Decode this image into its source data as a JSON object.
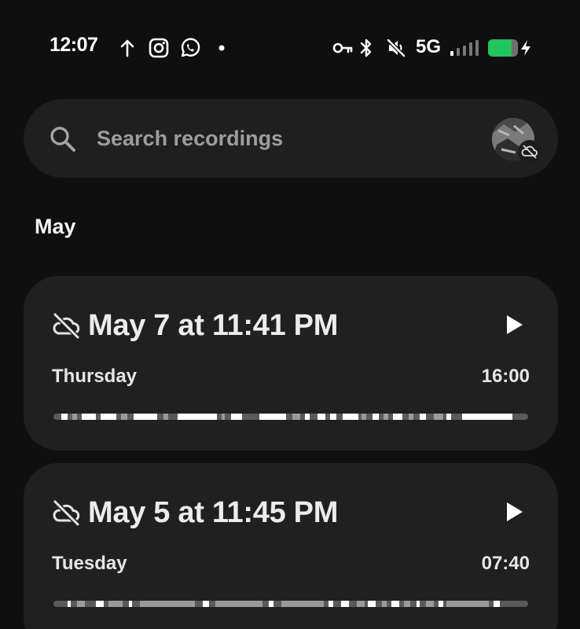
{
  "status_bar": {
    "time": "12:07",
    "network": "5G",
    "battery_color": "#22c55e",
    "icons": [
      "upload-arrow-icon",
      "instagram-icon",
      "whatsapp-icon",
      "notification-dot-icon",
      "vpn-key-icon",
      "bluetooth-icon",
      "mute-icon",
      "signal-icon",
      "battery-icon",
      "charging-icon"
    ]
  },
  "search": {
    "placeholder": "Search recordings"
  },
  "section": {
    "title": "May"
  },
  "recordings": [
    {
      "title": "May 7 at 11:41 PM",
      "day": "Thursday",
      "duration": "16:00"
    },
    {
      "title": "May 5 at 11:45 PM",
      "day": "Tuesday",
      "duration": "07:40"
    }
  ],
  "colors": {
    "background": "#0f0f0f",
    "card": "#202020",
    "search_bar": "#1f1f1f",
    "placeholder": "#9d9d9d"
  }
}
